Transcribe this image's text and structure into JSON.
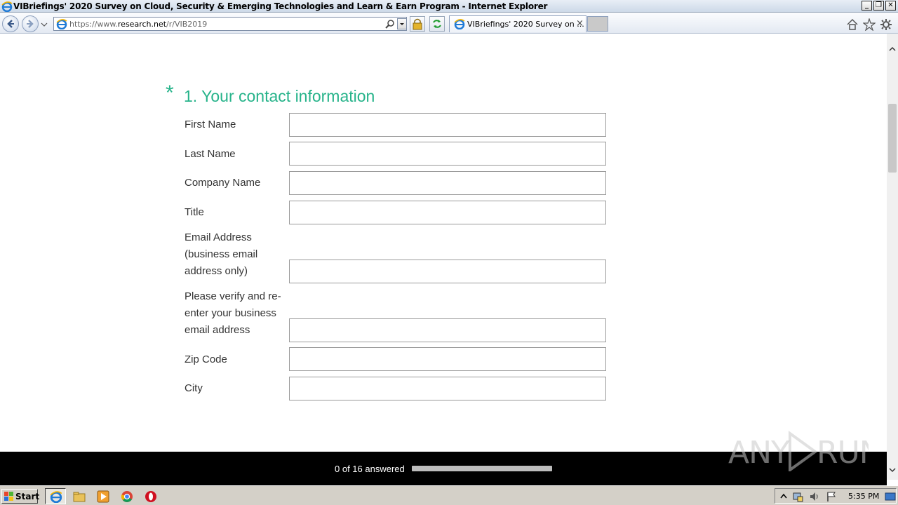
{
  "window": {
    "title": "VIBriefings' 2020 Survey on Cloud, Security & Emerging Technologies and Learn & Earn Program - Internet Explorer",
    "controls": [
      "minimize",
      "restore",
      "close"
    ]
  },
  "browser": {
    "url_prefix": "https://www.",
    "url_host": "research.net",
    "url_path": "/r/VIB2019",
    "tab_label": "VIBriefings' 2020 Survey on ...",
    "tab_close": "×",
    "right_icons": [
      "home-icon",
      "favorites-star-icon",
      "settings-gear-icon"
    ]
  },
  "survey": {
    "required_marker": "*",
    "question_title": "1. Your contact information",
    "fields": [
      {
        "label": "First Name",
        "value": ""
      },
      {
        "label": "Last Name",
        "value": ""
      },
      {
        "label": "Company Name",
        "value": ""
      },
      {
        "label": "Title",
        "value": ""
      },
      {
        "label": "Email Address (business email address only)",
        "value": ""
      },
      {
        "label": "Please verify and re-enter your business email address",
        "value": ""
      },
      {
        "label": "Zip Code",
        "value": ""
      },
      {
        "label": "City",
        "value": ""
      }
    ]
  },
  "footer": {
    "progress_text": "0 of 16 answered",
    "answered": 0,
    "total": 16,
    "progress_fraction": 0,
    "accent_color": "#26b38a"
  },
  "watermark": {
    "text": "ANY RUN"
  },
  "taskbar": {
    "start_label": "Start",
    "pinned": [
      "internet-explorer-icon",
      "file-explorer-icon",
      "media-player-icon",
      "chrome-icon",
      "opera-icon"
    ],
    "clock": "5:35 PM"
  }
}
